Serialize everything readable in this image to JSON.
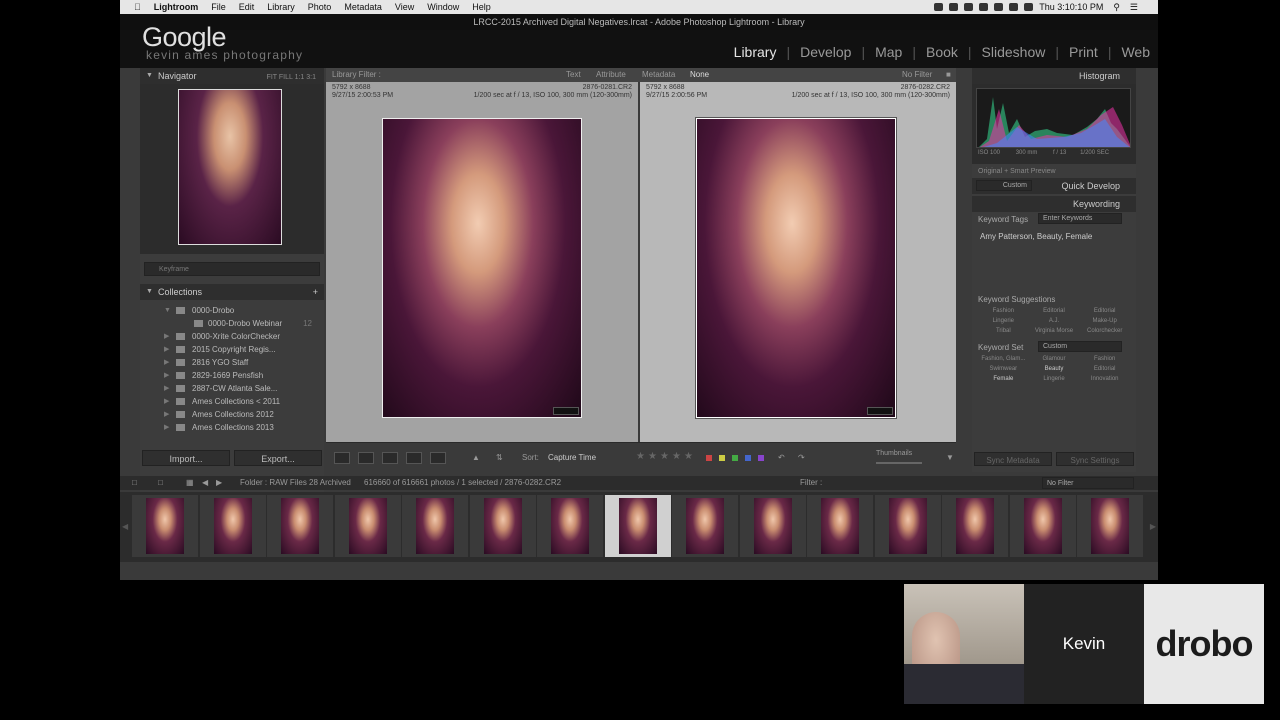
{
  "menubar": {
    "app": "Lightroom",
    "items": [
      "File",
      "Edit",
      "Library",
      "Photo",
      "Metadata",
      "View",
      "Window",
      "Help"
    ],
    "clock": "Thu 3:10:10 PM"
  },
  "titlebar": {
    "title": "LRCC-2015 Archived Digital Negatives.lrcat - Adobe Photoshop Lightroom - Library"
  },
  "brand": {
    "name": "Google",
    "sub": "kevin ames photography"
  },
  "modules": {
    "items": [
      "Library",
      "Develop",
      "Map",
      "Book",
      "Slideshow",
      "Print",
      "Web"
    ],
    "active": "Library"
  },
  "navigator": {
    "title": "Navigator",
    "zoom": "FIT  FILL  1:1  3:1"
  },
  "keyword_filter": {
    "placeholder": "Keyframe"
  },
  "collections": {
    "title": "Collections",
    "items": [
      {
        "label": "0000-Drobo",
        "sub": false,
        "count": ""
      },
      {
        "label": "0000-Drobo Webinar",
        "sub": true,
        "count": "12"
      },
      {
        "label": "0000-Xrite ColorChecker",
        "sub": false,
        "count": ""
      },
      {
        "label": "2015 Copyright Regis...",
        "sub": false,
        "count": ""
      },
      {
        "label": "2816 YGO Staff",
        "sub": false,
        "count": ""
      },
      {
        "label": "2829-1669 Pensfish",
        "sub": false,
        "count": ""
      },
      {
        "label": "2887-CW Atlanta Sale...",
        "sub": false,
        "count": ""
      },
      {
        "label": "Ames Collections < 2011",
        "sub": false,
        "count": ""
      },
      {
        "label": "Ames Collections 2012",
        "sub": false,
        "count": ""
      },
      {
        "label": "Ames Collections 2013",
        "sub": false,
        "count": ""
      }
    ]
  },
  "left_buttons": {
    "import": "Import...",
    "export": "Export..."
  },
  "library_filter": {
    "title": "Library Filter :",
    "text": "Text",
    "attribute": "Attribute",
    "metadata": "Metadata",
    "none": "None",
    "nofilter": "No Filter"
  },
  "compare": {
    "a": {
      "dims": "5792 x 8688",
      "date": "9/27/15 2:00:53 PM",
      "file": "2876-0281.CR2",
      "exif": "1/200 sec at f / 13, ISO 100, 300 mm (120-300mm)"
    },
    "b": {
      "dims": "5792 x 8688",
      "date": "9/27/15 2:00:56 PM",
      "file": "2876-0282.CR2",
      "exif": "1/200 sec at f / 13, ISO 100, 300 mm (120-300mm)"
    }
  },
  "toolbar": {
    "sort_label": "Sort:",
    "sort_value": "Capture Time",
    "thumbs": "Thumbnails"
  },
  "right_panel": {
    "histogram": "Histogram",
    "hist_info": {
      "iso": "ISO 100",
      "focal": "300 mm",
      "aperture": "f / 13",
      "shutter": "1/200 SEC"
    },
    "preview": "Original + Smart Preview",
    "quick_develop": "Quick Develop",
    "preset": "Custom",
    "keywording": "Keywording",
    "keyword_tags_label": "Keyword Tags",
    "keyword_tags_field": "Enter Keywords",
    "keywords": "Amy Patterson, Beauty, Female",
    "suggestions_title": "Keyword Suggestions",
    "suggestions": [
      "Fashion",
      "Editorial",
      "Editorial",
      "Lingerie",
      "A.J.",
      "Make-Up",
      "Tribal",
      "Virginia Morse",
      "Colorchecker"
    ],
    "keyword_set_label": "Keyword Set",
    "keyword_set_value": "Custom",
    "set_items": [
      "Fashion, Glam...",
      "Glamour",
      "Fashion",
      "Swimwear",
      "Beauty",
      "Editorial",
      "Female",
      "Lingerie",
      "Innovation"
    ],
    "sync_metadata": "Sync Metadata",
    "sync_settings": "Sync Settings"
  },
  "filmbar": {
    "folder": "Folder : RAW Files 28 Archived",
    "count": "616660 of 616661 photos / 1 selected / 2876-0282.CR2",
    "filter_label": "Filter :",
    "filter_value": "No Filter"
  },
  "video": {
    "name": "Kevin",
    "sponsor": "drobo"
  }
}
